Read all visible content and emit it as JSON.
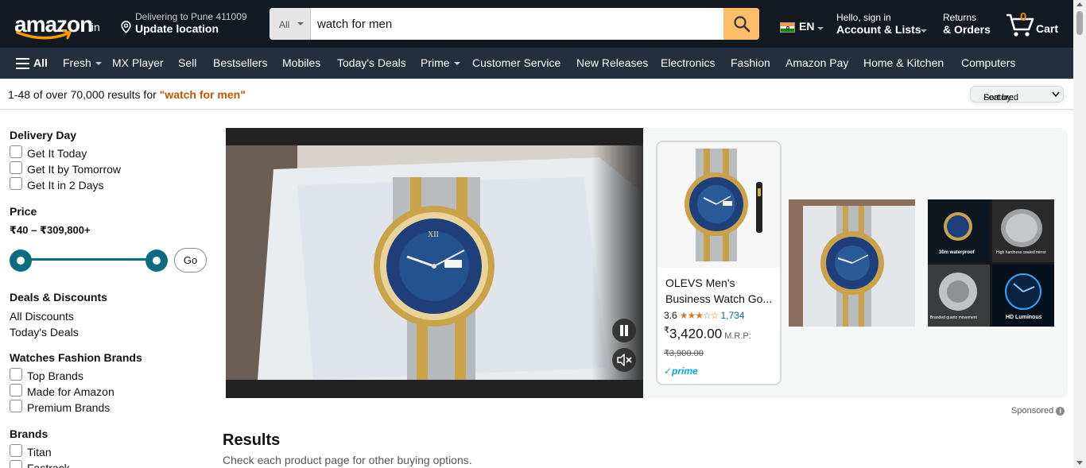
{
  "header": {
    "logo_text": "amazon",
    "logo_suffix": ".in",
    "deliver_line1": "Delivering to Pune 411009",
    "deliver_line2": "Update location",
    "search_category": "All",
    "search_value": "watch for men",
    "language": "EN",
    "account_line1": "Hello, sign in",
    "account_line2": "Account & Lists",
    "returns_line1": "Returns",
    "returns_line2": "& Orders",
    "cart_count": "0",
    "cart_label": "Cart"
  },
  "nav": {
    "all": "All",
    "items": [
      "Fresh",
      "MX Player",
      "Sell",
      "Bestsellers",
      "Mobiles",
      "Today's Deals",
      "Prime",
      "Customer Service",
      "New Releases",
      "Electronics",
      "Fashion",
      "Amazon Pay",
      "Home & Kitchen",
      "Computers"
    ]
  },
  "results_bar": {
    "count_text": "1-48 of over 70,000 results for ",
    "query": "\"watch for men\"",
    "sort_label": "Sort by:",
    "sort_value": "Featured"
  },
  "sidebar": {
    "delivery_heading": "Delivery Day",
    "delivery_options": [
      "Get It Today",
      "Get It by Tomorrow",
      "Get It in 2 Days"
    ],
    "price_heading": "Price",
    "price_range": "₹40 – ₹309,800+",
    "go_label": "Go",
    "deals_heading": "Deals & Discounts",
    "deals_links": [
      "All Discounts",
      "Today's Deals"
    ],
    "fashion_heading": "Watches Fashion Brands",
    "fashion_options": [
      "Top Brands",
      "Made for Amazon",
      "Premium Brands"
    ],
    "brands_heading": "Brands",
    "brands_options": [
      "Titan",
      "Fastrack"
    ]
  },
  "banner": {
    "product_title": "OLEVS Men's Business Watch Go...",
    "rating": "3.6",
    "rating_stars": "★★★☆☆",
    "rating_count": "1,734",
    "price_symbol": "₹",
    "price": "3,420.00",
    "mrp_label": "M.R.P:",
    "old_price": "₹3,900.00",
    "prime": "✓prime",
    "sponsored": "Sponsored",
    "thumb2_caption_a": "30m waterproof",
    "thumb2_caption_b": "High hardness coated mirror",
    "thumb2_caption_c": "Branded quartz movement",
    "thumb2_caption_d": "HD Luminous"
  },
  "results": {
    "heading": "Results",
    "subtext": "Check each product page for other buying options."
  },
  "colors": {
    "header_bg": "#131921",
    "subnav_bg": "#232f3e",
    "search_button": "#febd69",
    "query_orange": "#c45500",
    "link_teal": "#007185",
    "star_orange": "#de7921"
  }
}
